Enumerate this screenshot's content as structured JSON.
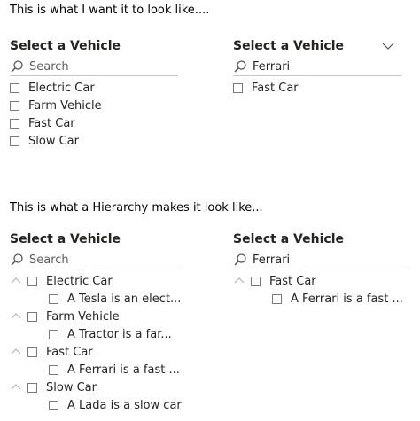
{
  "top": {
    "caption": "This is what I want it to look like....",
    "left_slicer": {
      "title": "Select a Vehicle",
      "search_placeholder": "Search",
      "items": [
        "Electric Car",
        "Farm Vehicle",
        "Fast Car",
        "Slow Car"
      ]
    },
    "right_slicer": {
      "title": "Select a Vehicle",
      "search_value": "Ferrari",
      "items": [
        "Fast Car"
      ]
    }
  },
  "bottom": {
    "caption": "This is what a Hierarchy makes it look like...",
    "left_slicer": {
      "title": "Select a Vehicle",
      "search_placeholder": "Search",
      "groups": [
        {
          "label": "Electric Car",
          "child": "A Tesla is an elect..."
        },
        {
          "label": "Farm Vehicle",
          "child": "A Tractor is a far..."
        },
        {
          "label": "Fast Car",
          "child": "A Ferrari is a fast ..."
        },
        {
          "label": "Slow Car",
          "child": "A Lada is a slow car"
        }
      ]
    },
    "right_slicer": {
      "title": "Select a Vehicle",
      "search_value": "Ferrari",
      "groups": [
        {
          "label": "Fast Car",
          "child": "A Ferrari is a fast ..."
        }
      ]
    }
  }
}
